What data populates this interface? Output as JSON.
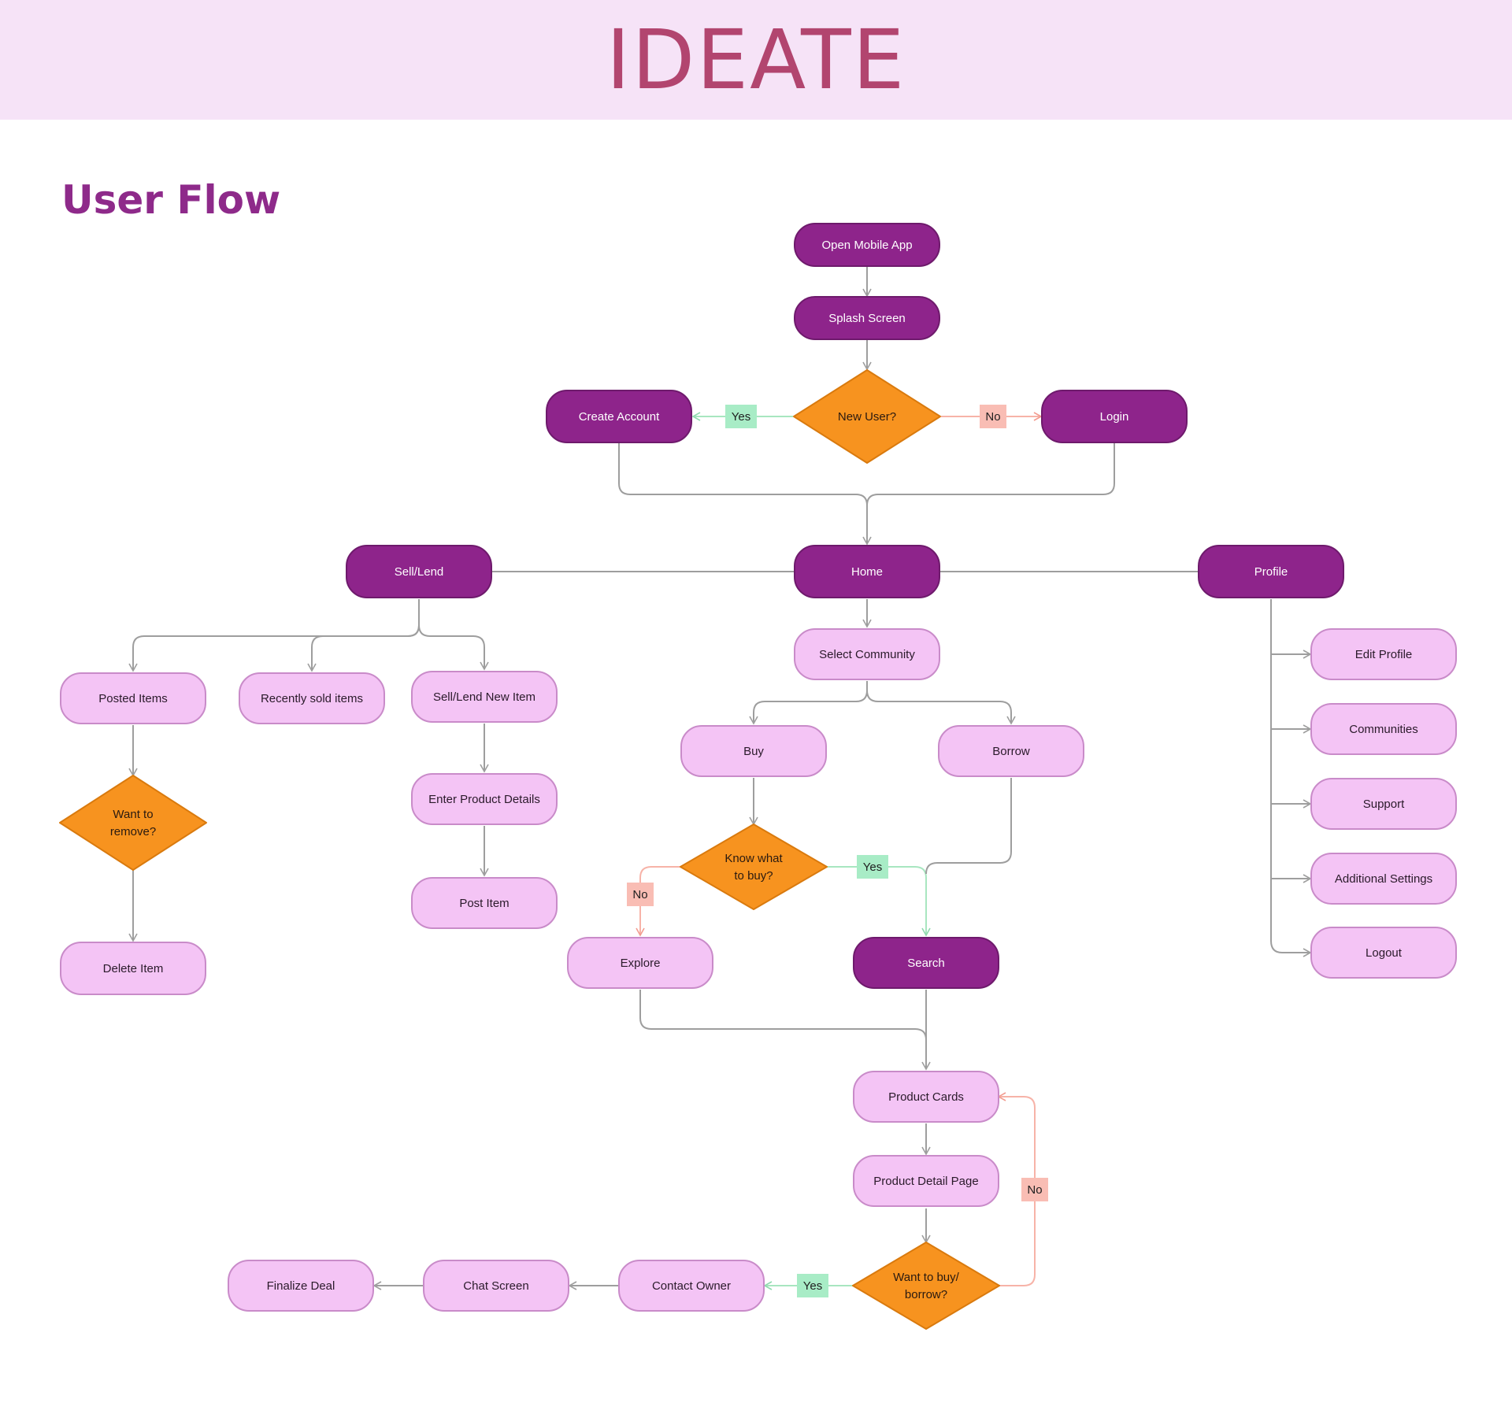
{
  "header": {
    "title": "IDEATE"
  },
  "section": {
    "title": "User Flow"
  },
  "colors": {
    "header_bg": "#f6e3f7",
    "dark_node": "#8e248b",
    "dark_node_border": "#6e1a6c",
    "light_node": "#f4c4f5",
    "light_node_border": "#c98bc9",
    "diamond": "#f7931f",
    "diamond_border": "#d97a0e",
    "yes_tag": "#a8ecc6",
    "no_tag": "#f9bdb4",
    "line": "#9e9e9e",
    "yes_line": "#a8e6c0",
    "no_line": "#f7b3a8"
  },
  "nodes": {
    "open_app": "Open Mobile App",
    "splash": "Splash Screen",
    "create_account": "Create Account",
    "login": "Login",
    "sell_lend": "Sell/Lend",
    "home": "Home",
    "profile": "Profile",
    "posted_items": "Posted Items",
    "recently_sold": "Recently sold items",
    "sell_lend_new": "Sell/Lend New Item",
    "enter_details": "Enter Product Details",
    "post_item": "Post Item",
    "delete_item": "Delete Item",
    "select_community": "Select Community",
    "buy": "Buy",
    "borrow": "Borrow",
    "explore": "Explore",
    "search": "Search",
    "product_cards": "Product Cards",
    "product_detail": "Product Detail Page",
    "contact_owner": "Contact Owner",
    "chat_screen": "Chat Screen",
    "finalize_deal": "Finalize Deal",
    "edit_profile": "Edit Profile",
    "communities": "Communities",
    "support": "Support",
    "additional_settings": "Additional Settings",
    "logout": "Logout"
  },
  "decisions": {
    "new_user": [
      "New User?"
    ],
    "want_remove": [
      "Want to",
      "remove?"
    ],
    "know_buy": [
      "Know what",
      "to buy?"
    ],
    "want_buy": [
      "Want to buy/",
      "borrow?"
    ]
  },
  "tags": {
    "yes": "Yes",
    "no": "No"
  }
}
